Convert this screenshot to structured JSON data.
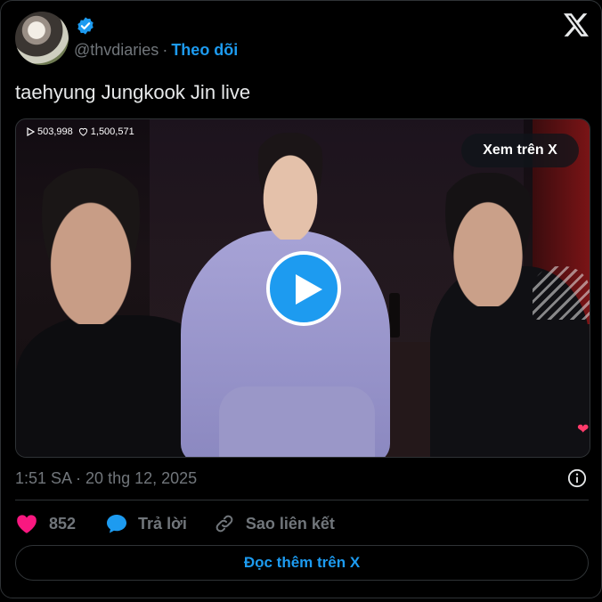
{
  "header": {
    "handle": "@thvdiaries",
    "separator": "·",
    "follow_label": "Theo dõi"
  },
  "tweet": {
    "text": "taehyung Jungkook Jin live"
  },
  "video": {
    "views": "503,998",
    "likes": "1,500,571",
    "watch_on_x_label": "Xem trên X"
  },
  "meta": {
    "timestamp": "1:51 SA · 20 thg 12, 2025"
  },
  "actions": {
    "like_count": "852",
    "reply_label": "Trả lời",
    "copy_link_label": "Sao liên kết"
  },
  "footer": {
    "read_more_label": "Đọc thêm trên X"
  },
  "colors": {
    "accent": "#1d9bf0",
    "like": "#f91880",
    "muted": "#71767b",
    "text": "#e7e9ea",
    "border": "#2f3336"
  },
  "icons": [
    "verified-badge-icon",
    "x-logo-icon",
    "play-icon",
    "heart-icon",
    "reply-bubble-icon",
    "link-icon",
    "info-icon"
  ]
}
